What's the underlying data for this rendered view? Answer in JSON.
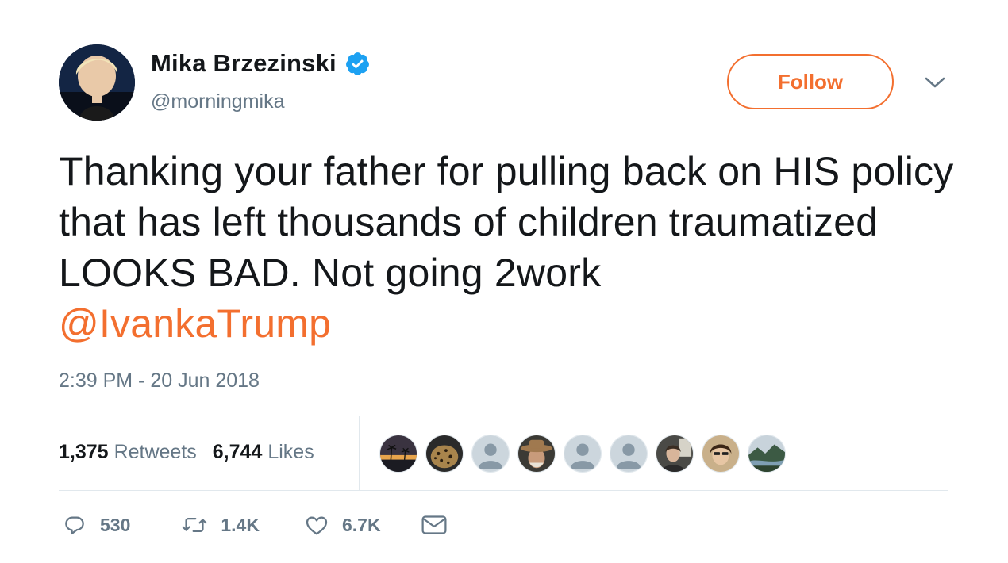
{
  "author": {
    "display_name": "Mika Brzezinski",
    "handle": "@morningmika",
    "verified": true
  },
  "header": {
    "follow_label": "Follow"
  },
  "tweet": {
    "text": "Thanking your father for pulling back on HIS policy that has left thousands of children traumatized LOOKS BAD. Not going 2work",
    "mention": "@IvankaTrump",
    "timestamp": "2:39 PM - 20 Jun 2018"
  },
  "stats": {
    "retweets_count": "1,375",
    "retweets_label": "Retweets",
    "likes_count": "6,744",
    "likes_label": "Likes"
  },
  "actions": {
    "replies": "530",
    "retweets": "1.4K",
    "likes": "6.7K"
  },
  "likers": [
    {
      "icon": "palm-sunset-avatar"
    },
    {
      "icon": "leopard-avatar"
    },
    {
      "icon": "default-profile-avatar"
    },
    {
      "icon": "cowboy-hat-avatar"
    },
    {
      "icon": "default-profile-avatar"
    },
    {
      "icon": "default-profile-avatar"
    },
    {
      "icon": "person-photo-avatar"
    },
    {
      "icon": "person-photo-avatar"
    },
    {
      "icon": "landscape-avatar"
    }
  ],
  "colors": {
    "accent": "#f36f2f",
    "verified": "#1da1f2",
    "muted_text": "#657786",
    "text": "#14171a",
    "divider": "#e1e8ed"
  }
}
